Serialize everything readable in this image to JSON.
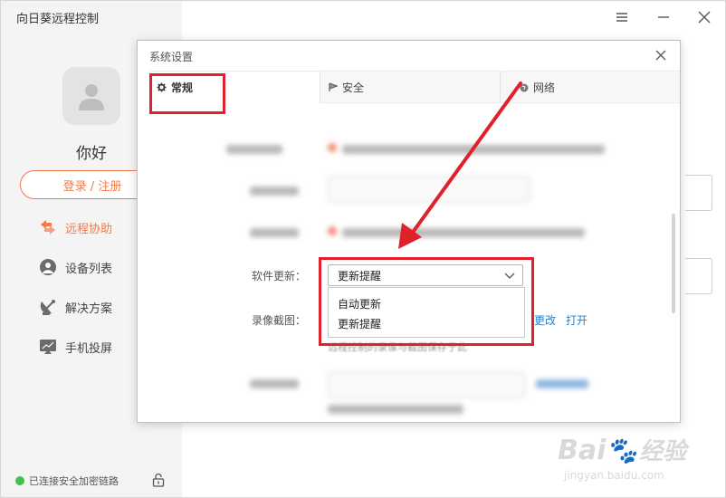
{
  "app": {
    "title": "向日葵远程控制",
    "greeting": "你好",
    "login_label": "登录 / 注册",
    "status_text": "已连接安全加密链路"
  },
  "sidebar": {
    "items": [
      {
        "label": "远程协助",
        "icon": "remote-assist-icon",
        "active": true
      },
      {
        "label": "设备列表",
        "icon": "device-list-icon",
        "active": false
      },
      {
        "label": "解决方案",
        "icon": "solution-icon",
        "active": false
      },
      {
        "label": "手机投屏",
        "icon": "phone-cast-icon",
        "active": false
      }
    ]
  },
  "dialog": {
    "title": "系统设置",
    "tabs": [
      {
        "label": "常规",
        "icon": "gear-icon",
        "active": true
      },
      {
        "label": "安全",
        "icon": "shield-icon",
        "active": false
      },
      {
        "label": "网络",
        "icon": "globe-icon",
        "active": false
      }
    ],
    "update": {
      "label": "软件更新：",
      "selected": "更新提醒",
      "options": [
        "自动更新",
        "更新提醒"
      ]
    },
    "recording": {
      "label": "录像截图：",
      "change_link": "更改",
      "open_link": "打开",
      "hint": "远程控制的录像与截图保存于此"
    }
  },
  "watermark": {
    "brand": "Bai",
    "brand_tail": "经验",
    "url": "jingyan.baidu.com"
  },
  "colors": {
    "accent": "#f07b4b",
    "highlight": "#e0202a",
    "link": "#1f80d8",
    "status_ok": "#3ec24c"
  }
}
